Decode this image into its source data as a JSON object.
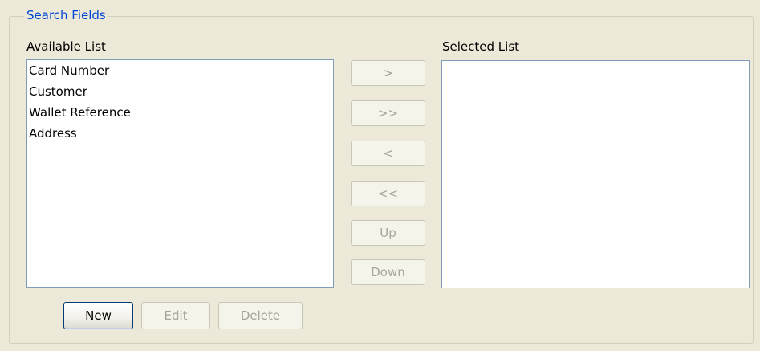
{
  "group": {
    "title": "Search Fields"
  },
  "available": {
    "label": "Available List",
    "items": [
      "Card Number",
      "Customer",
      "Wallet Reference",
      "Address"
    ]
  },
  "selected": {
    "label": "Selected List",
    "items": []
  },
  "move_buttons": {
    "move_right": ">",
    "move_all_right": ">>",
    "move_left": "<",
    "move_all_left": "<<",
    "up": "Up",
    "down": "Down"
  },
  "actions": {
    "new": "New",
    "edit": "Edit",
    "delete": "Delete"
  },
  "colors": {
    "panel_background": "#ece9d8",
    "legend_text": "#0046d5",
    "list_border": "#7f9db9",
    "disabled_text": "#a5a598"
  }
}
